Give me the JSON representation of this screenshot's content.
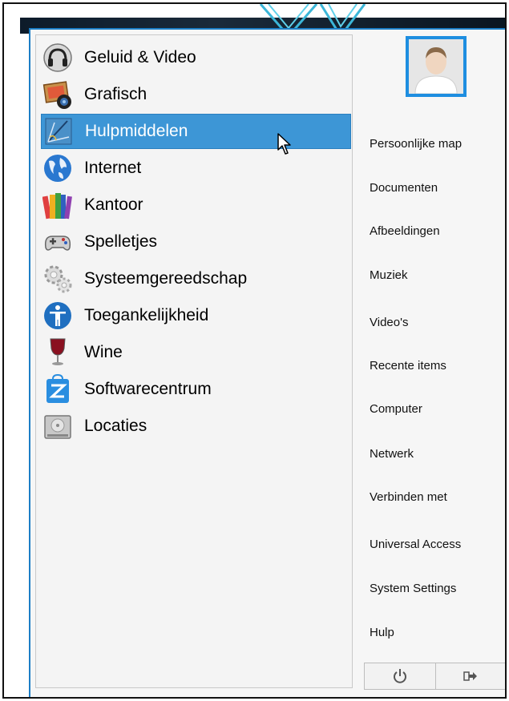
{
  "categories": [
    {
      "label": "Geluid & Video",
      "icon": "headphones-icon"
    },
    {
      "label": "Grafisch",
      "icon": "graphics-icon"
    },
    {
      "label": "Hulpmiddelen",
      "icon": "accessories-icon",
      "selected": true
    },
    {
      "label": "Internet",
      "icon": "globe-icon"
    },
    {
      "label": "Kantoor",
      "icon": "books-icon"
    },
    {
      "label": "Spelletjes",
      "icon": "gamepad-icon"
    },
    {
      "label": "Systeemgereedschap",
      "icon": "gears-icon"
    },
    {
      "label": "Toegankelijkheid",
      "icon": "accessibility-icon"
    },
    {
      "label": "Wine",
      "icon": "wine-glass-icon"
    },
    {
      "label": "Softwarecentrum",
      "icon": "software-center-icon"
    },
    {
      "label": "Locaties",
      "icon": "drive-icon"
    }
  ],
  "places": [
    {
      "label": "Persoonlijke map"
    },
    {
      "label": "Documenten"
    },
    {
      "label": "Afbeeldingen"
    },
    {
      "label": "Muziek"
    },
    {
      "label": "Video's"
    },
    {
      "label": "Recente items"
    },
    {
      "label": "Computer"
    },
    {
      "label": "Netwerk"
    },
    {
      "label": "Verbinden met"
    },
    {
      "label": "Universal Access"
    },
    {
      "label": "System Settings"
    },
    {
      "label": "Hulp"
    }
  ],
  "session": {
    "buttons": [
      {
        "icon": "power-icon"
      },
      {
        "icon": "logout-icon"
      }
    ]
  },
  "colors": {
    "selection": "#3d96d6",
    "accent": "#1c7ec6"
  }
}
